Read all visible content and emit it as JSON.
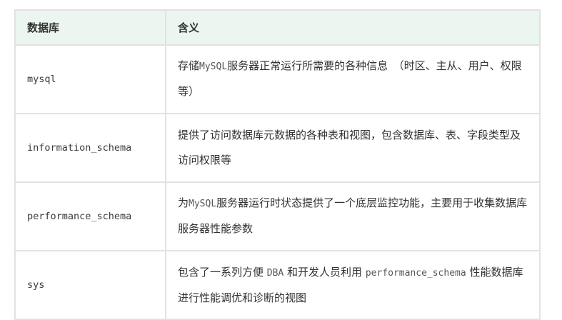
{
  "table": {
    "headers": [
      "数据库",
      "含义"
    ],
    "rows": [
      {
        "name": "mysql",
        "desc_a": "存储",
        "desc_code1": "MySQL",
        "desc_b": "服务器正常运行所需要的各种信息　（时区、主从、用户、权限等）",
        "desc_code2": "",
        "desc_c": ""
      },
      {
        "name": "information_schema",
        "desc_a": "提供了访问数据库元数据的各种表和视图，包含数据库、表、字段类型及访问权限等",
        "desc_code1": "",
        "desc_b": "",
        "desc_code2": "",
        "desc_c": ""
      },
      {
        "name": "performance_schema",
        "desc_a": "为",
        "desc_code1": "MySQL",
        "desc_b": "服务器运行时状态提供了一个底层监控功能，主要用于收集数据库服务器性能参数",
        "desc_code2": "",
        "desc_c": ""
      },
      {
        "name": "sys",
        "desc_a": "包含了一系列方便 ",
        "desc_code1": "DBA",
        "desc_b": " 和开发人员利用 ",
        "desc_code2": "performance_schema",
        "desc_c": " 性能数据库进行性能调优和诊断的视图"
      }
    ]
  }
}
